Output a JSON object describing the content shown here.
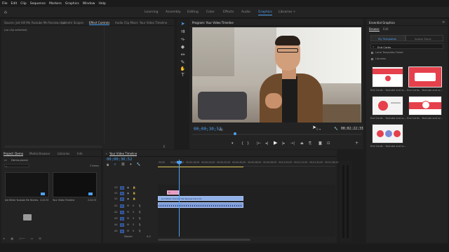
{
  "menu": [
    "File",
    "Edit",
    "Clip",
    "Sequence",
    "Markers",
    "Graphics",
    "Window",
    "Help"
  ],
  "workspaces": [
    {
      "label": "Learning",
      "active": false
    },
    {
      "label": "Assembly",
      "active": false
    },
    {
      "label": "Editing",
      "active": false
    },
    {
      "label": "Color",
      "active": false
    },
    {
      "label": "Effects",
      "active": false
    },
    {
      "label": "Audio",
      "active": false
    },
    {
      "label": "Graphics",
      "active": true
    },
    {
      "label": "Libraries",
      "active": false
    }
  ],
  "source_panel": {
    "tabs": [
      "Source: Jed Hill Me Youtube Me Review.mp4",
      "Lumetri Scopes",
      "Effect Controls",
      "Audio Clip Mixer: Your Video Timeline"
    ],
    "active_tab": "Effect Controls",
    "message": "(no clip selected)"
  },
  "program": {
    "title": "Program: Your Video Timeline",
    "timecode_in": "00;00;30;52",
    "fit": "Fit",
    "timecode_out": "00;02;22;33"
  },
  "project": {
    "tabs": [
      "Project: Demo",
      "Media Browser",
      "Libraries",
      "Info"
    ],
    "file": "Demo.prproj",
    "search_placeholder": "",
    "item_count": "3 Items",
    "items": [
      {
        "name": "Jed White Youtube Me Review.mp4",
        "duration": "2:22:33",
        "color": "#1a1a1a"
      },
      {
        "name": "Your Video Timeline",
        "duration": "2:22:33",
        "color": "#141414"
      }
    ]
  },
  "timeline": {
    "tab": "Your Video Timeline",
    "timecode": "00;00;30;52",
    "ruler": [
      "00;00",
      "00;00;08;00",
      "00;00;16;00",
      "00;00;24;00",
      "00;00;32;00",
      "00;00;40;00",
      "00;00;48;00",
      "00;00;56;00",
      "00;01;04;00",
      "00;01;12;00",
      "00;01;20;00",
      "00;01;28;00"
    ],
    "video_tracks": [
      "V3",
      "V2",
      "V1"
    ],
    "audio_tracks": [
      "A1",
      "A2",
      "A3",
      "A4",
      "A5"
    ],
    "clip_graphic": "fx",
    "clip_video": "Jed White Youtube Me Review.mp4 [V]",
    "master_label": "Master"
  },
  "graphics": {
    "panel_tabs": [
      "Essential Graphics"
    ],
    "subtabs": [
      "Browse",
      "Edit"
    ],
    "scopes": [
      "My Templates",
      "Adobe Stock"
    ],
    "search_value": "End Cards",
    "local_folder": "Local Templates Folder",
    "libraries": "Libraries",
    "templates": [
      {
        "label": "End Cards - Youtube end sc..."
      },
      {
        "label": "End Cards - Youtube end sc..."
      },
      {
        "label": "End Cards - Youtube end sc..."
      },
      {
        "label": "End Cards - Youtube end sc..."
      },
      {
        "label": "End Cards - Youtube end sc..."
      }
    ]
  },
  "colors": {
    "accent": "#4ea0f0",
    "clip_video": "#8fb0e8",
    "clip_graphic": "#e79ac3",
    "track_button": "#2c4a84"
  },
  "icons": [
    "selection-tool-icon",
    "track-select-icon",
    "ripple-edit-icon",
    "razor-icon",
    "slip-icon",
    "pen-icon",
    "hand-icon",
    "type-icon",
    "play-icon",
    "step-back-icon",
    "step-forward-icon",
    "marker-icon",
    "export-frame-icon",
    "wrench-icon",
    "folder-icon",
    "search-icon",
    "cursor-icon"
  ]
}
